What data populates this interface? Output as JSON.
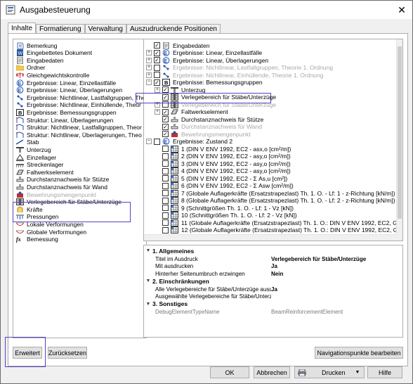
{
  "window": {
    "title": "Ausgabesteuerung",
    "close": "✕"
  },
  "tabs": [
    "Inhalte",
    "Formatierung",
    "Verwaltung",
    "Auszudruckende Positionen"
  ],
  "left_list": [
    {
      "label": "Bemerkung",
      "icon": "note-icon"
    },
    {
      "label": "Eingebettetes Dokument",
      "icon": "word-icon"
    },
    {
      "label": "Eingabedaten",
      "icon": "doc-icon"
    },
    {
      "label": "Ordner",
      "icon": "folder-icon"
    },
    {
      "label": "Gleichgewichtskontrolle",
      "icon": "balance-icon"
    },
    {
      "label": "Ergebnisse: Linear, Einzellastfälle",
      "icon": "result-icon"
    },
    {
      "label": "Ergebnisse: Linear, Überlagerungen",
      "icon": "result-icon"
    },
    {
      "label": "Ergebnisse: Nichtlinear, Lastfallgruppen, Theor",
      "icon": "result-nl-icon"
    },
    {
      "label": "Ergebnisse: Nichtlinear, Einhüllende, Theor",
      "icon": "result-nl-icon"
    },
    {
      "label": "Ergebnisse: Bemessungsgruppen",
      "icon": "b-icon"
    },
    {
      "label": "Struktur: Linear, Überlagerungen",
      "icon": "structure-icon"
    },
    {
      "label": "Struktur: Nichtlinear, Lastfallgruppen, Theor",
      "icon": "structure-icon"
    },
    {
      "label": "Struktur: Nichtlinear, Überlagerungen, Theo",
      "icon": "structure-icon"
    },
    {
      "label": "Stab",
      "icon": "beam-icon"
    },
    {
      "label": "Unterzug",
      "icon": "girder-icon"
    },
    {
      "label": "Einzellager",
      "icon": "support-icon"
    },
    {
      "label": "Streckenlager",
      "icon": "line-support-icon"
    },
    {
      "label": "Faltwerkselement",
      "icon": "shell-icon"
    },
    {
      "label": "Durchstanznachweis für Stütze",
      "icon": "punching-icon"
    },
    {
      "label": "Durchstanznachweis für Wand",
      "icon": "punching-icon"
    },
    {
      "label": "Bewehrungsmengenpunkt",
      "icon": "rebar-point-icon"
    },
    {
      "label": "Verlegebereich für Stäbe/Unterzüge",
      "icon": "layout-area-icon"
    },
    {
      "label": "Kräfte",
      "icon": "force-icon"
    },
    {
      "label": "Pressungen",
      "icon": "pressure-icon"
    },
    {
      "label": "Lokale Verformungen",
      "icon": "deform-icon"
    },
    {
      "label": "Globale Verformungen",
      "icon": "deform-icon"
    },
    {
      "label": "Bemessung",
      "icon": "fx-icon"
    }
  ],
  "tree": [
    {
      "label": "Eingabedaten",
      "exp": "",
      "checked": true,
      "gray": false,
      "indent": 0,
      "icon": "doc-icon"
    },
    {
      "label": "Ergebnisse: Linear, Einzellastfälle",
      "exp": "+",
      "checked": true,
      "gray": false,
      "indent": 0,
      "icon": "result-icon"
    },
    {
      "label": "Ergebnisse: Linear, Überlagerungen",
      "exp": "+",
      "checked": true,
      "gray": false,
      "indent": 0,
      "icon": "result-icon"
    },
    {
      "label": "Ergebnisse: Nichtlinear, Lastfallgruppen, Theorie 1. Ordnung",
      "exp": "+",
      "checked": false,
      "gray": true,
      "indent": 0,
      "icon": "result-nl-icon"
    },
    {
      "label": "Ergebnisse: Nichtlinear, Einhüllende, Theorie 1. Ordnung",
      "exp": "+",
      "checked": false,
      "gray": true,
      "indent": 0,
      "icon": "result-nl-icon"
    },
    {
      "label": "Ergebnisse: Bemessungsgruppen",
      "exp": "−",
      "checked": true,
      "gray": false,
      "indent": 0,
      "icon": "b-icon"
    },
    {
      "label": "Unterzug",
      "exp": "+",
      "checked": true,
      "gray": false,
      "indent": 1,
      "icon": "girder-icon"
    },
    {
      "label": "Verlegebereich für Stäbe/Unterzüge",
      "exp": "",
      "checked": true,
      "gray": false,
      "indent": 1,
      "icon": "layout-area-icon"
    },
    {
      "label": "Verlegebereich für Stäbe/Unterzüge",
      "exp": "+",
      "checked": false,
      "gray": true,
      "indent": 1,
      "icon": "layout-area-icon"
    },
    {
      "label": "Faltwerkselement",
      "exp": "+",
      "checked": true,
      "gray": false,
      "indent": 1,
      "icon": "shell-icon"
    },
    {
      "label": "Durchstanznachweis für Stütze",
      "exp": "",
      "checked": true,
      "gray": false,
      "indent": 1,
      "icon": "punching-icon"
    },
    {
      "label": "Durchstanznachweis für Wand",
      "exp": "",
      "checked": true,
      "gray": true,
      "indent": 1,
      "icon": "punching-icon"
    },
    {
      "label": "Bewehrungsmengenpunkt",
      "exp": "",
      "checked": true,
      "gray": true,
      "indent": 1,
      "icon": "rebar-point-icon"
    },
    {
      "label": "Ergebnisse: Zustand 2",
      "exp": "−",
      "checked": false,
      "gray": false,
      "indent": 0,
      "icon": "result-icon"
    },
    {
      "label": "1 (DIN V ENV 1992, EC2 - asx,o [cm²/m])",
      "exp": "",
      "checked": false,
      "gray": false,
      "indent": 1,
      "icon": "grid-icon"
    },
    {
      "label": "2 (DIN V ENV 1992, EC2 - asy,o [cm²/m])",
      "exp": "",
      "checked": false,
      "gray": false,
      "indent": 1,
      "icon": "grid-icon"
    },
    {
      "label": "3 (DIN V ENV 1992, EC2 - asy,o [cm²/m])",
      "exp": "",
      "checked": false,
      "gray": false,
      "indent": 1,
      "icon": "grid-icon"
    },
    {
      "label": "4 (DIN V ENV 1992, EC2 - asy,o [cm²/m])",
      "exp": "",
      "checked": false,
      "gray": false,
      "indent": 1,
      "icon": "grid-icon"
    },
    {
      "label": "5 (DIN V ENV 1992, EC2 - Σ As,u [cm²])",
      "exp": "",
      "checked": false,
      "gray": false,
      "indent": 1,
      "icon": "grid-icon"
    },
    {
      "label": "6 (DIN V ENV 1992, EC2 - Σ Asw [cm²/m])",
      "exp": "",
      "checked": false,
      "gray": false,
      "indent": 1,
      "icon": "grid-icon"
    },
    {
      "label": "7 (Globale Auflagerkräfte (Ersatzstrapezlast) Th. 1. O. - Lf: 1 - z-Richtung [kN/m])",
      "exp": "",
      "checked": false,
      "gray": false,
      "indent": 1,
      "icon": "grid-icon"
    },
    {
      "label": "8 (Globale Auflagerkräfte (Ersatzstrapezlast) Th. 1. O. - Lf: 2 - z-Richtung [kN/m])",
      "exp": "",
      "checked": false,
      "gray": false,
      "indent": 1,
      "icon": "grid-icon"
    },
    {
      "label": "9 (Schnittgrößen Th. 1. O. - Lf: 1 - Vz [kN])",
      "exp": "",
      "checked": false,
      "gray": false,
      "indent": 1,
      "icon": "grid-icon"
    },
    {
      "label": "10 (Schnittgrößen Th. 1. O. - Lf: 2 - Vz [kN])",
      "exp": "",
      "checked": false,
      "gray": false,
      "indent": 1,
      "icon": "grid-icon"
    },
    {
      "label": "11 (Globale Auflagerkräfte (Ersatzstrapezlast) Th. 1. O.: DIN V ENV 1992, EC2, Grundkombinat",
      "exp": "",
      "checked": false,
      "gray": false,
      "indent": 1,
      "icon": "grid-icon"
    },
    {
      "label": "12 (Globale Auflagerkräfte (Ersatzstrapezlast) Th. 1. O.: DIN V ENV 1992, EC2, Grundkombinat",
      "exp": "",
      "checked": false,
      "gray": false,
      "indent": 1,
      "icon": "grid-icon"
    }
  ],
  "properties": {
    "groups": [
      {
        "header": "1.  Allgemeines",
        "rows": [
          {
            "key": "Titel im Ausdruck",
            "value": "Verlegebereich für Stäbe/Unterzüge"
          },
          {
            "key": "Mit ausdrucken",
            "value": "Ja"
          },
          {
            "key": "Hinterher Seitenumbruch erzwingen",
            "value": "Nein"
          }
        ]
      },
      {
        "header": "2.  Einschränkungen",
        "rows": [
          {
            "key": "Alle Verlegebereiche für Stäbe/Unterzüge ausd",
            "value": "Ja"
          },
          {
            "key": "Ausgewählte Verlegebereiche für Stäbe/Unterz",
            "value": ""
          }
        ]
      },
      {
        "header": "3.  Sonstiges",
        "rows": [
          {
            "key": "DebugElementTypeName",
            "value": "BeamReinforcementElement"
          }
        ]
      }
    ]
  },
  "buttons": {
    "erweitert": "Erweitert",
    "zuruecksetzen": "Zurücksetzen",
    "navigation": "Navigationspunkte bearbeiten",
    "ok": "OK",
    "abbrechen": "Abbrechen",
    "drucken": "Drucken",
    "hilfe": "Hilfe"
  },
  "colors": {
    "highlight": "#5b3fc4",
    "accent": "#1e5bb8",
    "disabled_text": "#a8a8a8"
  }
}
